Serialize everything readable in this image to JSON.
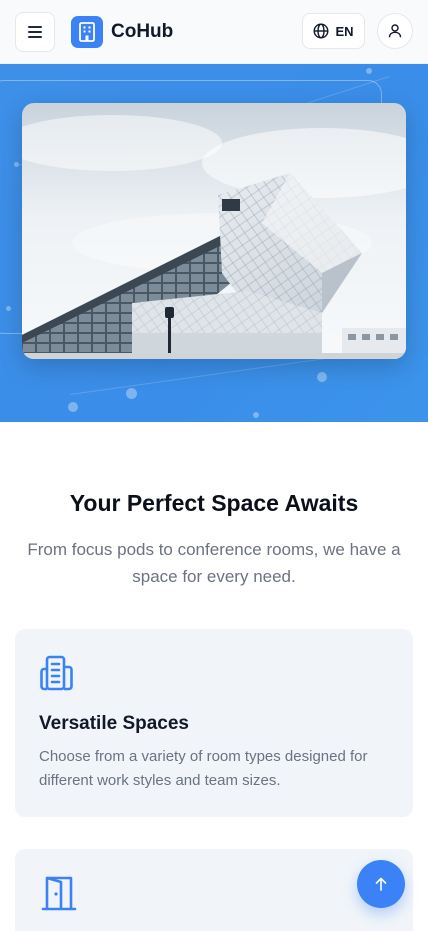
{
  "header": {
    "brand": "CoHub",
    "language": "EN",
    "icons": {
      "menu": "hamburger-menu-icon",
      "logo": "building-icon",
      "language": "globe-icon",
      "user": "user-icon"
    }
  },
  "hero": {
    "image": "modern-glass-building-photo"
  },
  "features": {
    "title": "Your Perfect Space Awaits",
    "subtitle": "From focus pods to conference rooms, we have a space for every need.",
    "cards": [
      {
        "icon": "building-icon",
        "title": "Versatile Spaces",
        "description": "Choose from a variety of room types designed for different work styles and team sizes."
      },
      {
        "icon": "door-icon"
      }
    ]
  },
  "fab": {
    "icon": "arrow-up-icon"
  },
  "colors": {
    "accent": "#3b82f6",
    "hero": "#3a8de8",
    "card": "#f1f5f9",
    "muted_text": "#6b7280"
  }
}
